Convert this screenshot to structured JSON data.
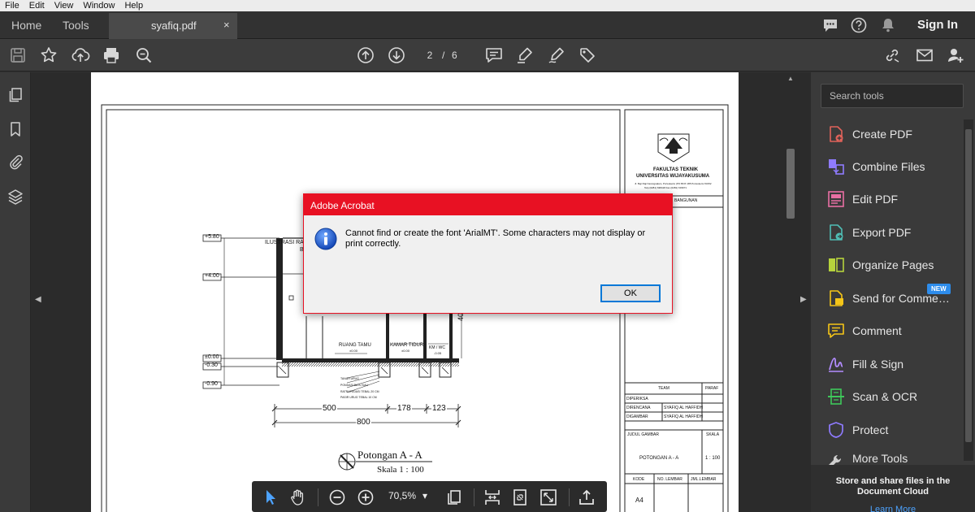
{
  "menu": [
    "File",
    "Edit",
    "View",
    "Window",
    "Help"
  ],
  "tabs": {
    "home": "Home",
    "tools": "Tools",
    "document": "syafiq.pdf",
    "close": "×"
  },
  "header": {
    "sign_in": "Sign In"
  },
  "toolbar": {
    "current_page": "2",
    "separator": "/",
    "total_pages": "6"
  },
  "right_panel": {
    "search_placeholder": "Search tools",
    "tools": [
      {
        "label": "Create PDF",
        "icon": "create-pdf-icon",
        "color": "#e0625a"
      },
      {
        "label": "Combine Files",
        "icon": "combine-files-icon",
        "color": "#8f7bff"
      },
      {
        "label": "Edit PDF",
        "icon": "edit-pdf-icon",
        "color": "#e86fa3"
      },
      {
        "label": "Export PDF",
        "icon": "export-pdf-icon",
        "color": "#4fbdb4"
      },
      {
        "label": "Organize Pages",
        "icon": "organize-pages-icon",
        "color": "#b6d33c"
      },
      {
        "label": "Send for Comme…",
        "icon": "send-for-comments-icon",
        "color": "#f5c518"
      },
      {
        "label": "Comment",
        "icon": "comment-icon",
        "color": "#f5c518"
      },
      {
        "label": "Fill & Sign",
        "icon": "fill-sign-icon",
        "color": "#b38cff"
      },
      {
        "label": "Scan & OCR",
        "icon": "scan-ocr-icon",
        "color": "#3ec85a"
      },
      {
        "label": "Protect",
        "icon": "protect-icon",
        "color": "#8f7bff"
      },
      {
        "label": "More Tools",
        "icon": "more-tools-icon",
        "color": "#cfcfcf"
      }
    ],
    "new_badge": "NEW",
    "store_text": "Store and share files in the Document Cloud",
    "learn_more": "Learn More"
  },
  "floating_toolbar": {
    "zoom": "70,5%",
    "zoom_dropdown": "▾"
  },
  "dialog": {
    "title": "Adobe Acrobat",
    "message": "Cannot find or create the font 'ArialMT'. Some characters may not display or print correctly.",
    "ok": "OK"
  },
  "drawing": {
    "elev_580": "+5.80",
    "elev_400": "+4.00",
    "elev_000": "±0.00",
    "elev_m030": "-0.30",
    "elev_m090": "-0.90",
    "illus_label": "ILUSTRASI RA",
    "illus_label2": "B",
    "room_tamu": "RUANG TAMU",
    "room_tidur": "KAMAR TIDUR",
    "room_km": "KM / WC",
    "room_level_tamu": "±0.00",
    "room_level_tidur": "±0.00",
    "room_level_km": "-0.05",
    "dim_400": "400",
    "dim_500": "500",
    "dim_178": "178",
    "dim_123": "123",
    "dim_800": "800",
    "note1": "TANAH URUG",
    "note2": "PONDASI BATU KALI",
    "note3": "RATRAPEDASI TEBAL 20 CM",
    "note4": "PASIR URUG TEBAL 10 CM",
    "section_title": "Potongan A - A",
    "section_scale": "Skala 1 : 100",
    "faculty": "FAKULTAS TEKNIK",
    "university": "UNIVERSITAS WIJAYAKUSUMA",
    "address": "Jl. Beji Raji Karangsalam, Purwokerto (PO BOX 185 Purwokerto 53152",
    "phone": "Telp (0281) 638418 Fax (0281) 633971",
    "tb_bangunan": "BANGUNAN",
    "tb_team": "TEAM",
    "tb_paraf": "PARAF",
    "tb_diperiksa": "DIPERIKSA",
    "tb_direncana": "DIRENCANA",
    "tb_direncana_val": "SYAFIQ AL HAFFIDH",
    "tb_digambar": "DIGAMBAR",
    "tb_digambar_val": "SYAFIQ AL HAFFIDH",
    "tb_judul": "JUDUL GAMBAR",
    "tb_skala": "SKALA",
    "tb_potongan": "POTONGAN A - A",
    "tb_skala_val": "1 : 100",
    "tb_kode": "KODE",
    "tb_no_lembar": "NO. LEMBAR",
    "tb_jml_lembar": "JML.LEMBAR",
    "tb_a4": "A4"
  }
}
